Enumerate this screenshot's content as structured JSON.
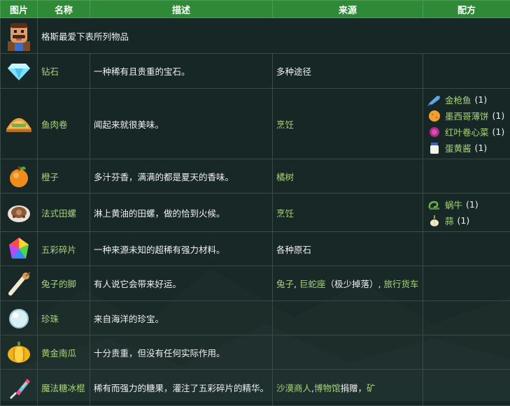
{
  "headers": {
    "image": "图片",
    "name": "名称",
    "description": "描述",
    "source": "来源",
    "recipe": "配方"
  },
  "intro": "格斯最爱下表所列物品",
  "items": [
    {
      "icon": "diamond-icon",
      "name": "钻石",
      "description": "一种稀有且贵重的宝石。",
      "source": "多种途径"
    },
    {
      "icon": "fish-taco-icon",
      "name": "鱼肉卷",
      "description": "闻起来就很美味。",
      "source": "烹饪",
      "recipe": [
        {
          "icon": "tuna-icon",
          "name": "金枪鱼",
          "count": "(1)"
        },
        {
          "icon": "tortilla-icon",
          "name": "墨西哥薄饼",
          "count": "(1)"
        },
        {
          "icon": "red-cabbage-icon",
          "name": "红叶卷心菜",
          "count": "(1)"
        },
        {
          "icon": "mayonnaise-icon",
          "name": "蛋黄酱",
          "count": "(1)"
        }
      ]
    },
    {
      "icon": "orange-icon",
      "name": "橙子",
      "description": "多汁芬香，满满的都是夏天的香味。",
      "source": "橘树"
    },
    {
      "icon": "escargot-icon",
      "name": "法式田螺",
      "description": "淋上黄油的田螺，做的恰到火候。",
      "source": "烹饪",
      "recipe": [
        {
          "icon": "snail-icon",
          "name": "蜗牛",
          "count": "(1)"
        },
        {
          "icon": "garlic-icon",
          "name": "蒜",
          "count": "(1)"
        }
      ]
    },
    {
      "icon": "prismatic-shard-icon",
      "name": "五彩碎片",
      "description": "一种来源未知的超稀有强力材料。",
      "source": "各种原石"
    },
    {
      "icon": "rabbit-foot-icon",
      "name": "兔子的脚",
      "description": "有人说它会带来好运。",
      "source_parts": [
        "兔子",
        ", ",
        "巨蛇座",
        "（极少掉落）, ",
        "旅行货车"
      ]
    },
    {
      "icon": "pearl-icon",
      "name": "珍珠",
      "description": "来自海洋的珍宝。",
      "source": ""
    },
    {
      "icon": "golden-pumpkin-icon",
      "name": "黄金南瓜",
      "description": "十分贵重，但没有任何实际作用。",
      "source": ""
    },
    {
      "icon": "magic-rock-candy-icon",
      "name": "魔法糖冰棍",
      "description": "稀有而强力的糖果，灌注了五彩碎片的精华。",
      "source_parts": [
        "沙漠商人",
        ",",
        "博物馆",
        "捐赠，",
        "矿"
      ]
    }
  ],
  "colors": {
    "header_bg": "#2f8a38",
    "link_green": "#a9d27a",
    "row_border": "#3a4a47"
  }
}
